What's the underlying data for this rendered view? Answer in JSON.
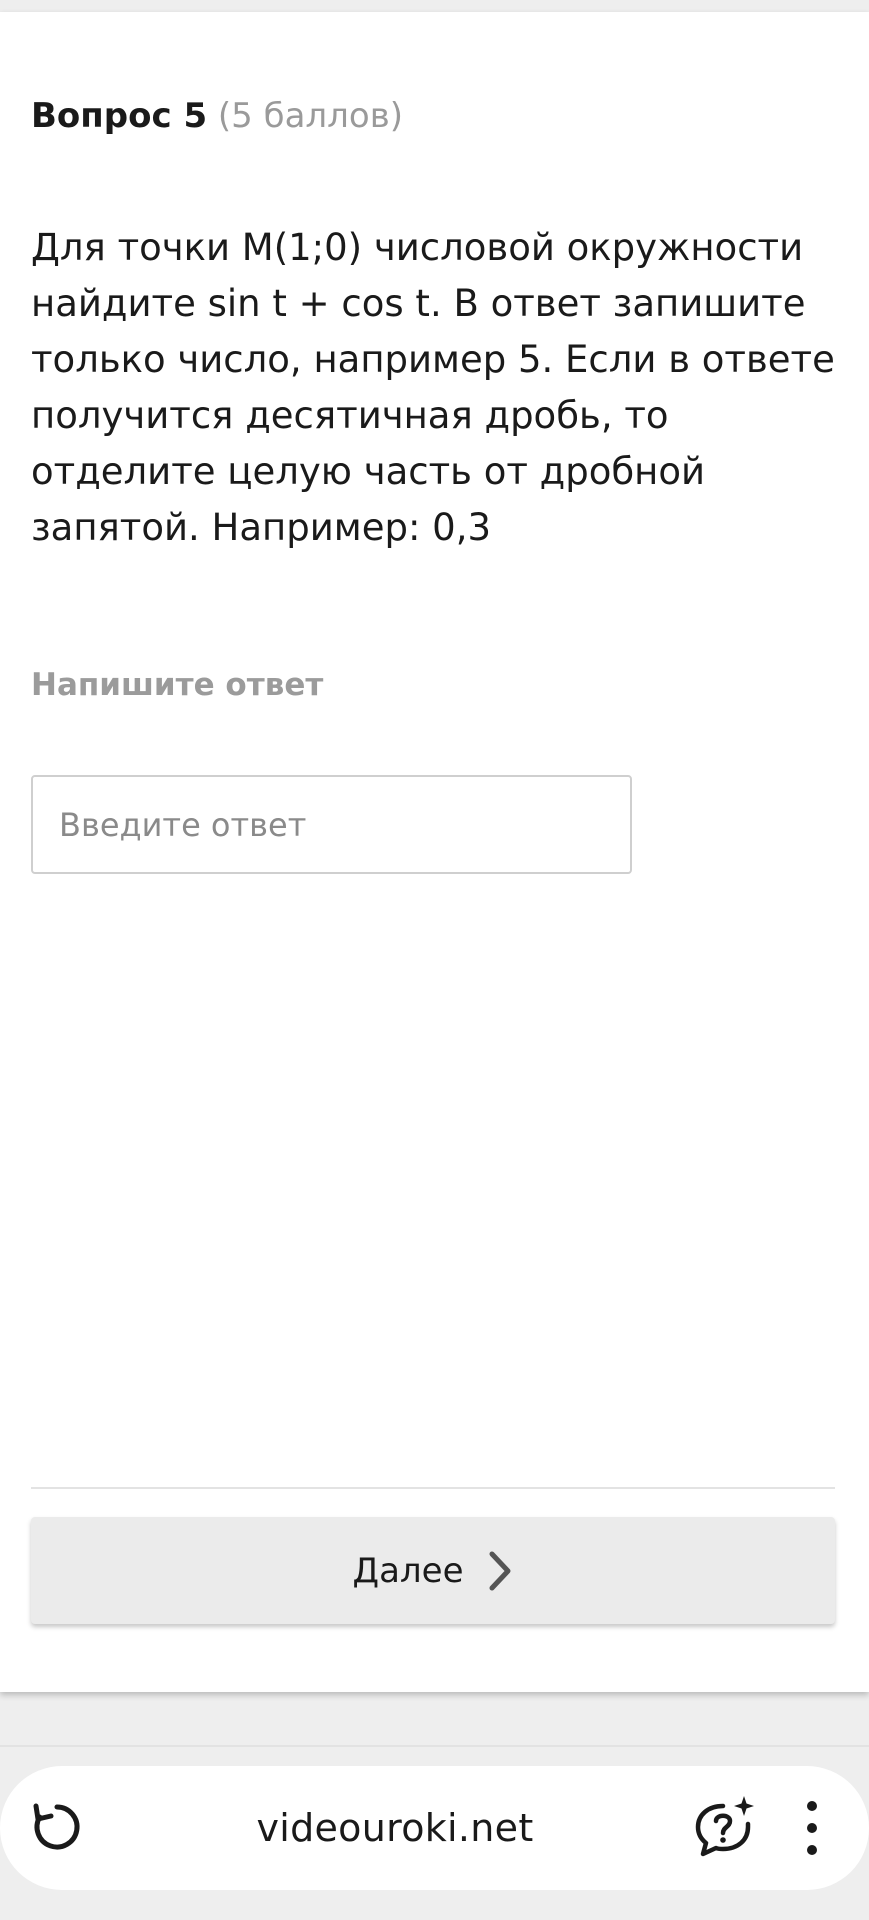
{
  "question": {
    "title": "Вопрос 5",
    "points": "(5 баллов)",
    "text": "Для точки M(1;0) числовой окружности найдите sin t + cos t. В ответ запишите только число, например 5. Если в ответе получится десятичная дробь, то отделите целую часть от дробной запятой. Например: 0,3"
  },
  "answer": {
    "label": "Напишите ответ",
    "value": "",
    "placeholder": "Введите ответ"
  },
  "next_button": {
    "label": "Далее",
    "icon": "chevron-right-icon"
  },
  "browser": {
    "url": "videouroki.net",
    "icons": [
      "reload-icon",
      "assistant-chat-icon",
      "more-vertical-icon"
    ]
  }
}
